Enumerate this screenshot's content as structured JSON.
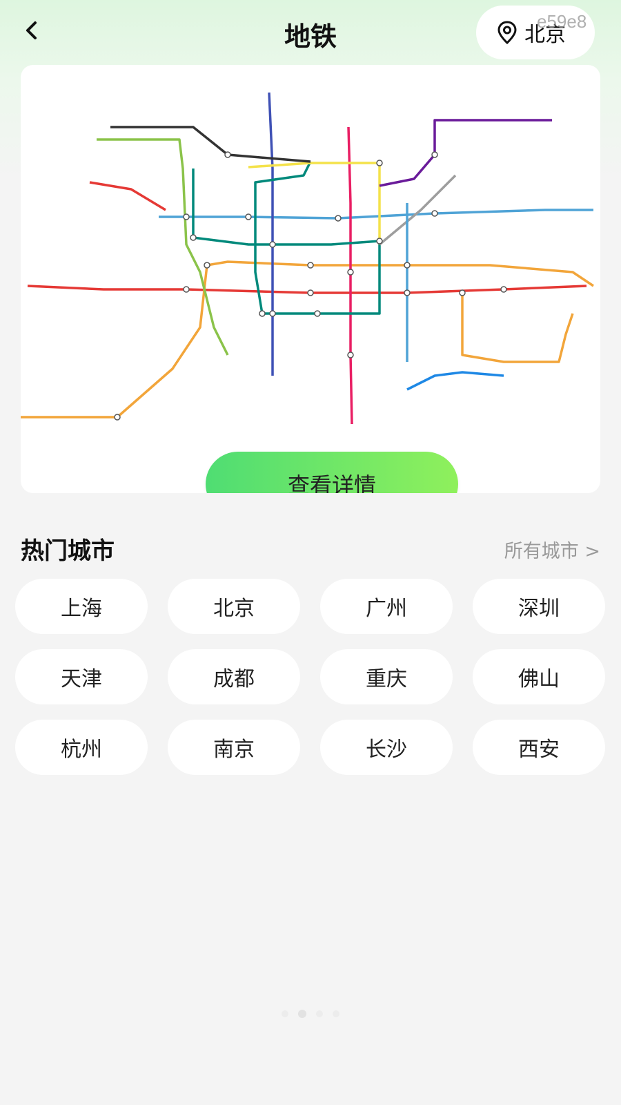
{
  "header": {
    "title": "地铁",
    "location": "北京",
    "overlay_code": "e59e8"
  },
  "map": {
    "detail_button": "查看详情",
    "line_colors": [
      "#e53935",
      "#f2a53a",
      "#4fa3d6",
      "#8bc34a",
      "#3f51b5",
      "#e91e63",
      "#00897b",
      "#f4e24a",
      "#6a1b9a",
      "#9e9e9e",
      "#333333",
      "#1e88e5"
    ]
  },
  "hot_cities": {
    "title": "热门城市",
    "all_link": "所有城市 >",
    "cities": [
      "上海",
      "北京",
      "广州",
      "深圳",
      "天津",
      "成都",
      "重庆",
      "佛山",
      "杭州",
      "南京",
      "长沙",
      "西安"
    ]
  },
  "pager": {
    "count": 4,
    "active": 1
  }
}
